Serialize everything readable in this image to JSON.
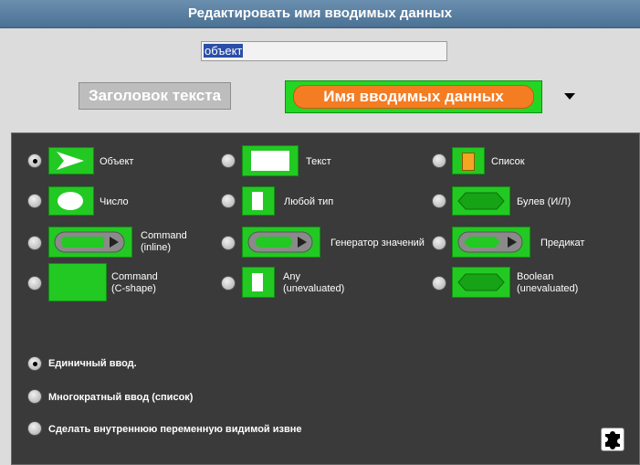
{
  "dialog": {
    "title": "Редактировать имя вводимых данных"
  },
  "name_field": {
    "value": "объект"
  },
  "header": {
    "title_slot": "Заголовок текста",
    "input_slot": "Имя вводимых данных"
  },
  "types": [
    {
      "label": "Объект",
      "selected": true
    },
    {
      "label": "Текст",
      "selected": false
    },
    {
      "label": "Список",
      "selected": false
    },
    {
      "label": "Число",
      "selected": false
    },
    {
      "label": "Любой тип",
      "selected": false
    },
    {
      "label": "Булев (И/Л)",
      "selected": false
    },
    {
      "label": "Command\n(inline)",
      "selected": false
    },
    {
      "label": "Генератор значений",
      "selected": false
    },
    {
      "label": "Предикат",
      "selected": false
    },
    {
      "label": "Command\n(C-shape)",
      "selected": false
    },
    {
      "label": "Any\n(unevaluated)",
      "selected": false
    },
    {
      "label": "Boolean\n(unevaluated)",
      "selected": false
    }
  ],
  "footer": {
    "single": "Единичный ввод.",
    "multi": "Многократный ввод (список)",
    "visible": "Сделать внутреннюю переменную видимой извне"
  },
  "colors": {
    "block_green": "#22c922",
    "slot_orange": "#f47c22",
    "panel": "#3a3a3a",
    "titlebar": "#4a7194"
  }
}
